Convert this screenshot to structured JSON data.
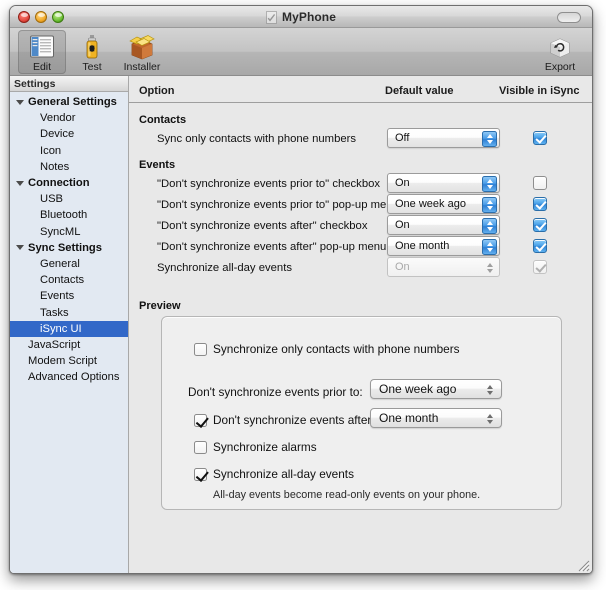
{
  "window": {
    "title": "MyPhone",
    "traffic_lights": [
      "close",
      "minimize",
      "zoom"
    ]
  },
  "toolbar": {
    "items": [
      {
        "label": "Edit",
        "icon": "document-list-icon",
        "selected": true
      },
      {
        "label": "Test",
        "icon": "spray-can-icon",
        "selected": false
      },
      {
        "label": "Installer",
        "icon": "open-box-icon",
        "selected": false
      }
    ],
    "right_items": [
      {
        "label": "Export",
        "icon": "export-box-icon",
        "selected": false
      }
    ]
  },
  "sidebar": {
    "header": "Settings",
    "items": [
      {
        "label": "General Settings",
        "type": "group",
        "expanded": true
      },
      {
        "label": "Vendor",
        "type": "child"
      },
      {
        "label": "Device",
        "type": "child"
      },
      {
        "label": "Icon",
        "type": "child"
      },
      {
        "label": "Notes",
        "type": "child"
      },
      {
        "label": "Connection",
        "type": "group",
        "expanded": true
      },
      {
        "label": "USB",
        "type": "child"
      },
      {
        "label": "Bluetooth",
        "type": "child"
      },
      {
        "label": "SyncML",
        "type": "child"
      },
      {
        "label": "Sync Settings",
        "type": "group",
        "expanded": true
      },
      {
        "label": "General",
        "type": "child"
      },
      {
        "label": "Contacts",
        "type": "child"
      },
      {
        "label": "Events",
        "type": "child"
      },
      {
        "label": "Tasks",
        "type": "child"
      },
      {
        "label": "iSync UI",
        "type": "child",
        "selected": true
      },
      {
        "label": "JavaScript",
        "type": "child2"
      },
      {
        "label": "Modem Script",
        "type": "child2"
      },
      {
        "label": "Advanced Options",
        "type": "child2"
      }
    ]
  },
  "table": {
    "columns": {
      "option": "Option",
      "default_value": "Default value",
      "visible_in_isync": "Visible in iSync"
    },
    "sections": [
      {
        "title": "Contacts",
        "rows": [
          {
            "label": "Sync only contacts with phone numbers",
            "default_value": "Off",
            "enabled": true,
            "visible_checked": true,
            "visible_enabled": true
          }
        ]
      },
      {
        "title": "Events",
        "rows": [
          {
            "label": "\"Don't synchronize events prior to\" checkbox",
            "default_value": "On",
            "enabled": true,
            "visible_checked": false,
            "visible_enabled": true
          },
          {
            "label": "\"Don't synchronize events prior to\" pop-up menu",
            "default_value": "One week ago",
            "enabled": true,
            "visible_checked": true,
            "visible_enabled": true
          },
          {
            "label": "\"Don't synchronize events after\" checkbox",
            "default_value": "On",
            "enabled": true,
            "visible_checked": true,
            "visible_enabled": true
          },
          {
            "label": "\"Don't synchronize events after\" pop-up menu",
            "default_value": "One month",
            "enabled": true,
            "visible_checked": true,
            "visible_enabled": true
          },
          {
            "label": "Synchronize all-day events",
            "default_value": "On",
            "enabled": false,
            "visible_checked": true,
            "visible_enabled": false
          }
        ]
      }
    ]
  },
  "preview": {
    "label": "Preview",
    "rows": [
      {
        "kind": "checkbox",
        "checked": false,
        "text": "Synchronize only contacts with phone numbers"
      },
      {
        "kind": "label-popup",
        "text": "Don't synchronize events prior to:",
        "value": "One week ago"
      },
      {
        "kind": "checkbox-popup",
        "checked": true,
        "text": "Don't synchronize events after:",
        "value": "One month"
      },
      {
        "kind": "checkbox",
        "checked": false,
        "text": "Synchronize alarms"
      },
      {
        "kind": "checkbox",
        "checked": true,
        "text": "Synchronize all-day events"
      },
      {
        "kind": "note",
        "text": "All-day events become read-only events on your phone."
      }
    ]
  },
  "colors": {
    "selection_blue": "#3268c8",
    "sidebar_bg": "#e2e9f2",
    "window_bg": "#e8e8e8",
    "aqua_blue": "#2f84d6"
  }
}
